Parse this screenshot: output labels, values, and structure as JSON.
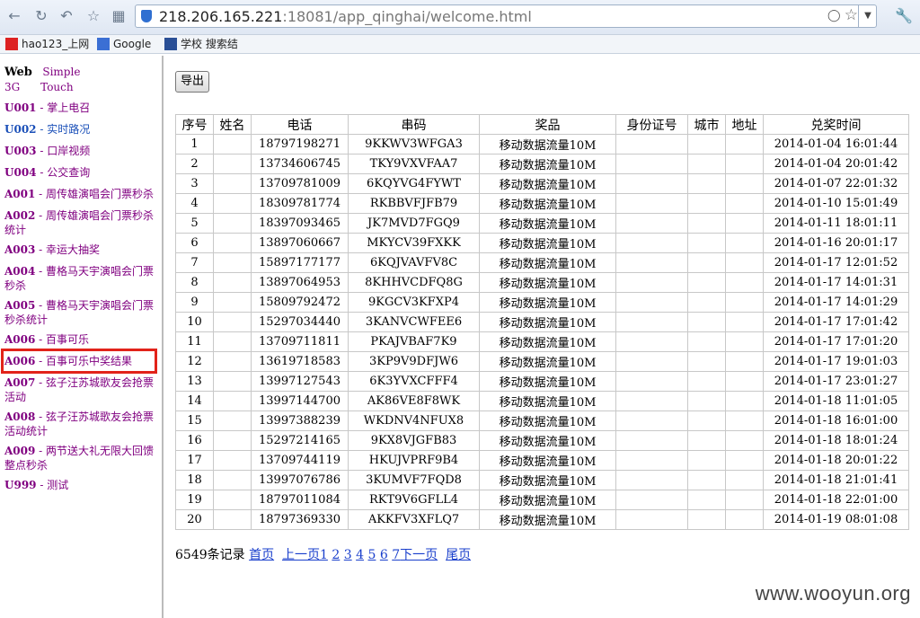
{
  "browser": {
    "url_host": "218.206.165.221",
    "url_rest": ":18081/app_qinghai/welcome.html",
    "bookmarks": [
      "hao123_上网",
      "Google",
      "学校 搜索结"
    ]
  },
  "sidebar": {
    "top_web": "Web",
    "top_simple": "Simple",
    "top_3g": "3G",
    "top_touch": "Touch",
    "items": [
      {
        "code": "U001",
        "label": " - 掌上电召"
      },
      {
        "code": "U002",
        "label": " - 实时路况"
      },
      {
        "code": "U003",
        "label": " - 口岸视频"
      },
      {
        "code": "U004",
        "label": " - 公交查询"
      },
      {
        "code": "A001",
        "label": " - 周传雄演唱会门票秒杀"
      },
      {
        "code": "A002",
        "label": " - 周传雄演唱会门票秒杀统计"
      },
      {
        "code": "A003",
        "label": " - 幸运大抽奖"
      },
      {
        "code": "A004",
        "label": " - 曹格马天宇演唱会门票秒杀"
      },
      {
        "code": "A005",
        "label": " - 曹格马天宇演唱会门票秒杀统计"
      },
      {
        "code": "A006",
        "label": " - 百事可乐"
      },
      {
        "code": "A006",
        "label": " - 百事可乐中奖结果"
      },
      {
        "code": "A007",
        "label": " - 弦子汪苏城歌友会抢票活动"
      },
      {
        "code": "A008",
        "label": " - 弦子汪苏城歌友会抢票活动统计"
      },
      {
        "code": "A009",
        "label": " - 两节送大礼无限大回馈整点秒杀"
      },
      {
        "code": "U999",
        "label": " - 测试"
      }
    ]
  },
  "main": {
    "export_label": "导出",
    "columns": [
      "序号",
      "姓名",
      "电话",
      "串码",
      "奖品",
      "身份证号",
      "城市",
      "地址",
      "兑奖时间"
    ],
    "rows": [
      [
        "1",
        "",
        "18797198271",
        "9KKWV3WFGA3",
        "移动数据流量10M",
        "",
        "",
        "",
        "2014-01-04 16:01:44"
      ],
      [
        "2",
        "",
        "13734606745",
        "TKY9VXVFAA7",
        "移动数据流量10M",
        "",
        "",
        "",
        "2014-01-04 20:01:42"
      ],
      [
        "3",
        "",
        "13709781009",
        "6KQYVG4FYWT",
        "移动数据流量10M",
        "",
        "",
        "",
        "2014-01-07 22:01:32"
      ],
      [
        "4",
        "",
        "18309781774",
        "RKBBVFJFB79",
        "移动数据流量10M",
        "",
        "",
        "",
        "2014-01-10 15:01:49"
      ],
      [
        "5",
        "",
        "18397093465",
        "JK7MVD7FGQ9",
        "移动数据流量10M",
        "",
        "",
        "",
        "2014-01-11 18:01:11"
      ],
      [
        "6",
        "",
        "13897060667",
        "MKYCV39FXKK",
        "移动数据流量10M",
        "",
        "",
        "",
        "2014-01-16 20:01:17"
      ],
      [
        "7",
        "",
        "15897177177",
        "6KQJVAVFV8C",
        "移动数据流量10M",
        "",
        "",
        "",
        "2014-01-17 12:01:52"
      ],
      [
        "8",
        "",
        "13897064953",
        "8KHHVCDFQ8G",
        "移动数据流量10M",
        "",
        "",
        "",
        "2014-01-17 14:01:31"
      ],
      [
        "9",
        "",
        "15809792472",
        "9KGCV3KFXP4",
        "移动数据流量10M",
        "",
        "",
        "",
        "2014-01-17 14:01:29"
      ],
      [
        "10",
        "",
        "15297034440",
        "3KANVCWFEE6",
        "移动数据流量10M",
        "",
        "",
        "",
        "2014-01-17 17:01:42"
      ],
      [
        "11",
        "",
        "13709711811",
        "PKAJVBAF7K9",
        "移动数据流量10M",
        "",
        "",
        "",
        "2014-01-17 17:01:20"
      ],
      [
        "12",
        "",
        "13619718583",
        "3KP9V9DFJW6",
        "移动数据流量10M",
        "",
        "",
        "",
        "2014-01-17 19:01:03"
      ],
      [
        "13",
        "",
        "13997127543",
        "6K3YVXCFFF4",
        "移动数据流量10M",
        "",
        "",
        "",
        "2014-01-17 23:01:27"
      ],
      [
        "14",
        "",
        "13997144700",
        "AK86VE8F8WK",
        "移动数据流量10M",
        "",
        "",
        "",
        "2014-01-18 11:01:05"
      ],
      [
        "15",
        "",
        "13997388239",
        "WKDNV4NFUX8",
        "移动数据流量10M",
        "",
        "",
        "",
        "2014-01-18 16:01:00"
      ],
      [
        "16",
        "",
        "15297214165",
        "9KX8VJGFB83",
        "移动数据流量10M",
        "",
        "",
        "",
        "2014-01-18 18:01:24"
      ],
      [
        "17",
        "",
        "13709744119",
        "HKUJVPRF9B4",
        "移动数据流量10M",
        "",
        "",
        "",
        "2014-01-18 20:01:22"
      ],
      [
        "18",
        "",
        "13997076786",
        "3KUMVF7FQD8",
        "移动数据流量10M",
        "",
        "",
        "",
        "2014-01-18 21:01:41"
      ],
      [
        "19",
        "",
        "18797011084",
        "RKT9V6GFLL4",
        "移动数据流量10M",
        "",
        "",
        "",
        "2014-01-18 22:01:00"
      ],
      [
        "20",
        "",
        "18797369330",
        "AKKFV3XFLQ7",
        "移动数据流量10M",
        "",
        "",
        "",
        "2014-01-19 08:01:08"
      ]
    ],
    "pager": {
      "count": "6549条记录",
      "first": "首页",
      "prev": "上一页",
      "pages": [
        "1",
        "2",
        "3",
        "4",
        "5",
        "6",
        "7"
      ],
      "next": "下一页",
      "last": "尾页"
    }
  },
  "watermark": "www.wooyun.org"
}
